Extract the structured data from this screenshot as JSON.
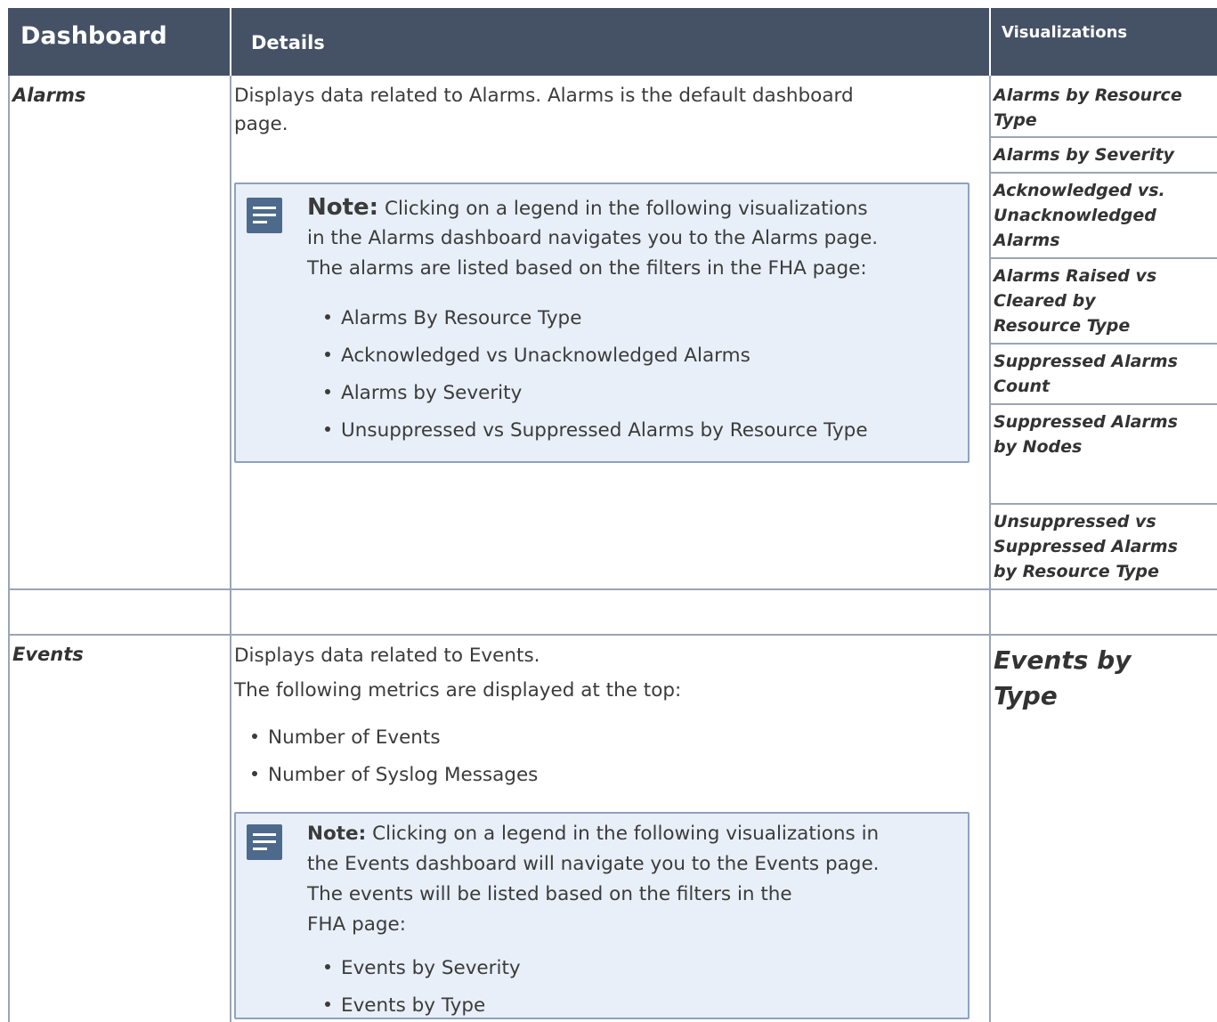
{
  "header": {
    "dashboard": "Dashboard",
    "details": "Details",
    "visualizations": "Visualizations"
  },
  "alarms": {
    "name": "Alarms",
    "details_line1": "Displays data related to Alarms. Alarms is the default dashboard",
    "details_line2": "page.",
    "note": {
      "label": "Note:",
      "line1": "Clicking on a legend in the following visualizations",
      "line2": "in the Alarms dashboard navigates you to the Alarms page.",
      "line3": "The alarms are listed based on the filters in the FHA page:",
      "bullets": [
        "Alarms By Resource Type",
        "Acknowledged vs Unacknowledged Alarms",
        "Alarms by Severity",
        "Unsuppressed vs Suppressed Alarms by Resource Type"
      ]
    },
    "visualizations": [
      [
        "Alarms by Resource",
        "Type"
      ],
      [
        "Alarms by Severity"
      ],
      [
        "Acknowledged vs.",
        "Unacknowledged",
        "Alarms"
      ],
      [
        "Alarms Raised vs",
        "Cleared by",
        "Resource Type"
      ],
      [
        "Suppressed Alarms",
        "Count"
      ],
      [
        "Suppressed Alarms",
        "by Nodes"
      ],
      [
        "Unsuppressed vs",
        "Suppressed Alarms",
        "by Resource Type"
      ]
    ]
  },
  "events": {
    "name": "Events",
    "details_line1": "Displays data related to Events.",
    "details_line2": "The following metrics are displayed at the top:",
    "metrics": [
      "Number of Events",
      "Number of Syslog Messages"
    ],
    "note": {
      "label": "Note:",
      "line1": "Clicking on a legend in the following visualizations in",
      "line2": "the Events dashboard will navigate you to the Events page.",
      "line3": "The events will be listed based on the filters in the",
      "line4": "FHA page:",
      "bullets": [
        "Events by Severity",
        "Events by Type"
      ]
    },
    "visualization": [
      "Events by",
      "Type"
    ]
  },
  "colors": {
    "header_bg": "#455266",
    "note_bg": "#e8eff8",
    "note_border": "#8ea2bd",
    "note_icon": "#4d6a8c"
  },
  "icons": [
    "note-icon"
  ]
}
